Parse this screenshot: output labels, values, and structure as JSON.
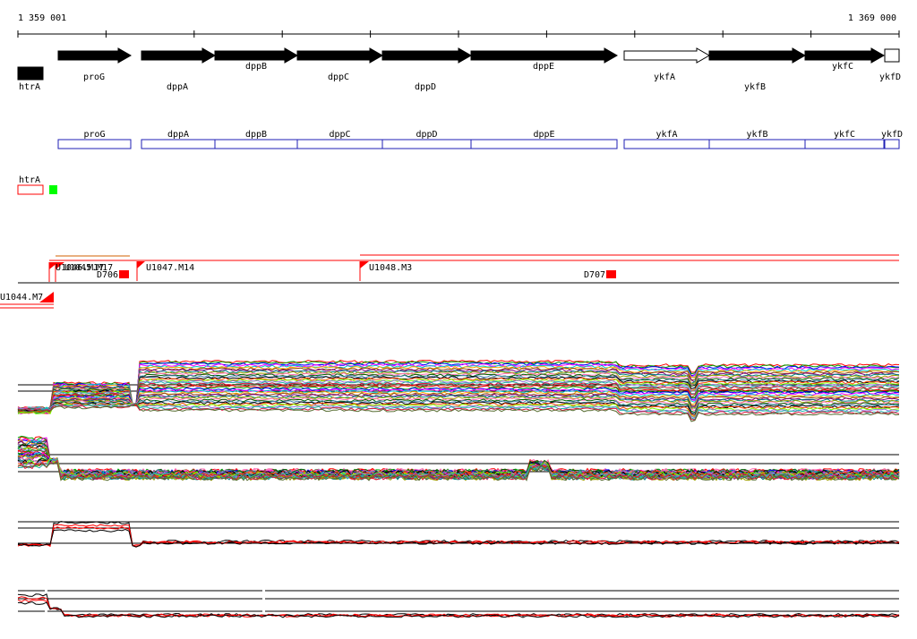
{
  "ruler": {
    "start_label": "1 359 001",
    "end_label": "1 369 000"
  },
  "genes": [
    {
      "id": "htrA",
      "label": "htrA",
      "fill": "#000000"
    },
    {
      "id": "proG",
      "label": "proG",
      "fill": "#000000"
    },
    {
      "id": "dppA",
      "label": "dppA",
      "fill": "#000000"
    },
    {
      "id": "dppB",
      "label": "dppB",
      "fill": "#000000"
    },
    {
      "id": "dppC",
      "label": "dppC",
      "fill": "#000000"
    },
    {
      "id": "dppD",
      "label": "dppD",
      "fill": "#000000"
    },
    {
      "id": "dppE",
      "label": "dppE",
      "fill": "#000000"
    },
    {
      "id": "ykfA",
      "label": "ykfA",
      "fill": "#ffffff"
    },
    {
      "id": "ykfB",
      "label": "ykfB",
      "fill": "#000000"
    },
    {
      "id": "ykfC",
      "label": "ykfC",
      "fill": "#000000"
    },
    {
      "id": "ykfD",
      "label": "ykfD",
      "fill": "#ffffff"
    }
  ],
  "operon_boxes": [
    "proG",
    "dppA",
    "dppB",
    "dppC",
    "dppD",
    "dppE",
    "ykfA",
    "ykfB",
    "ykfC",
    "ykfD"
  ],
  "upstream_gene": {
    "label": "htrA"
  },
  "features": [
    {
      "id": "U1046.M17",
      "label": "U1046.M17"
    },
    {
      "id": "U1045.M17",
      "label": "U1045.M17"
    },
    {
      "id": "U1044.M7",
      "label": "U1044.M7"
    },
    {
      "id": "D706",
      "label": "D706"
    },
    {
      "id": "U1047.M14",
      "label": "U1047.M14"
    },
    {
      "id": "U1048.M3",
      "label": "U1048.M3"
    },
    {
      "id": "D707",
      "label": "D707"
    }
  ],
  "colors": {
    "operon_box": "#1f1fb4",
    "feature_red": "#ff0000",
    "marker_green": "#00ff00",
    "profile_palette": [
      "#ff0000",
      "#00a000",
      "#0000ff",
      "#ff00ff",
      "#00c8c8",
      "#ffa500",
      "#8b4513",
      "#800080",
      "#008080",
      "#a0a000",
      "#ff69b4",
      "#006400",
      "#4682b4",
      "#000000",
      "#ff4500",
      "#7cfc00",
      "#9370db",
      "#20b2aa",
      "#dc143c",
      "#556b2f"
    ]
  }
}
